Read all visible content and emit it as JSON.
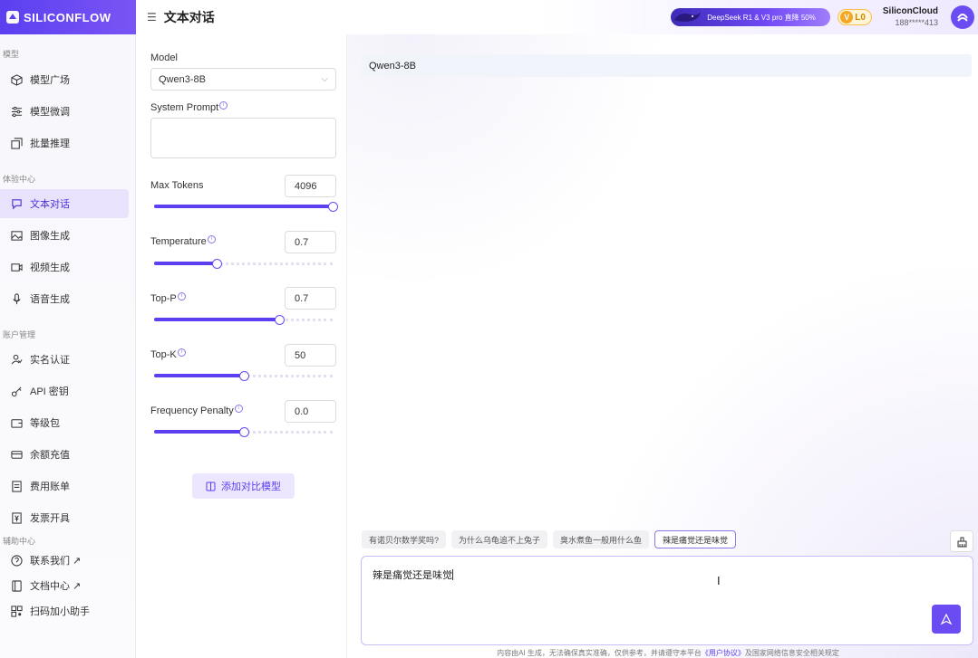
{
  "brand": {
    "name": "SILICONFLOW"
  },
  "header": {
    "title": "文本对话",
    "promo_text": "DeepSeek R1 & V3 pro 直降 50%",
    "level_letter": "V",
    "level": "L0",
    "account_name": "SiliconCloud",
    "account_phone": "188*****413"
  },
  "sidebar": {
    "sections": [
      {
        "label": "模型",
        "items": [
          {
            "label": "模型广场",
            "icon": "cube-icon"
          },
          {
            "label": "模型微调",
            "icon": "sliders-icon"
          },
          {
            "label": "批量推理",
            "icon": "batch-icon"
          }
        ]
      },
      {
        "label": "体验中心",
        "items": [
          {
            "label": "文本对话",
            "icon": "chat-icon",
            "active": true
          },
          {
            "label": "图像生成",
            "icon": "image-icon"
          },
          {
            "label": "视频生成",
            "icon": "video-icon"
          },
          {
            "label": "语音生成",
            "icon": "mic-icon"
          }
        ]
      },
      {
        "label": "账户管理",
        "items": [
          {
            "label": "实名认证",
            "icon": "user-check-icon"
          },
          {
            "label": "API 密钥",
            "icon": "key-icon"
          },
          {
            "label": "等级包",
            "icon": "wallet-icon"
          },
          {
            "label": "余额充值",
            "icon": "card-icon"
          },
          {
            "label": "费用账单",
            "icon": "bill-icon"
          },
          {
            "label": "发票开具",
            "icon": "invoice-icon"
          }
        ]
      },
      {
        "label": "辅助中心",
        "items": [
          {
            "label": "联系我们 ↗",
            "icon": "help-icon"
          },
          {
            "label": "文档中心 ↗",
            "icon": "book-icon"
          },
          {
            "label": "扫码加小助手",
            "icon": "qr-icon"
          }
        ]
      }
    ]
  },
  "params": {
    "model_label": "Model",
    "model_value": "Qwen3-8B",
    "system_prompt_label": "System Prompt",
    "max_tokens": {
      "label": "Max Tokens",
      "value": "4096",
      "fraction": 1.0
    },
    "temperature": {
      "label": "Temperature",
      "value": "0.7",
      "fraction": 0.35
    },
    "top_p": {
      "label": "Top-P",
      "value": "0.7",
      "fraction": 0.7
    },
    "top_k": {
      "label": "Top-K",
      "value": "50",
      "fraction": 0.5
    },
    "frequency_penalty": {
      "label": "Frequency Penalty",
      "value": "0.0",
      "fraction": 0.5
    },
    "add_compare_label": "添加对比模型"
  },
  "chat": {
    "model_tag": "Qwen3-8B",
    "suggestions": [
      "有诺贝尔数学奖吗?",
      "为什么乌龟追不上兔子",
      "臭水煮鱼一般用什么鱼",
      "辣是痛觉还是味觉"
    ],
    "selected_suggestion_index": 3,
    "input_value": "辣是痛觉还是味觉",
    "disclaimer_prefix": "内容由AI 生成，无法确保真实准确，仅供参考，并请遵守本平台",
    "disclaimer_link": "《用户协议》",
    "disclaimer_suffix": "及国家网络信息安全相关规定"
  },
  "colors": {
    "accent": "#5b3ff0",
    "active_bg": "#e8e2fd"
  }
}
